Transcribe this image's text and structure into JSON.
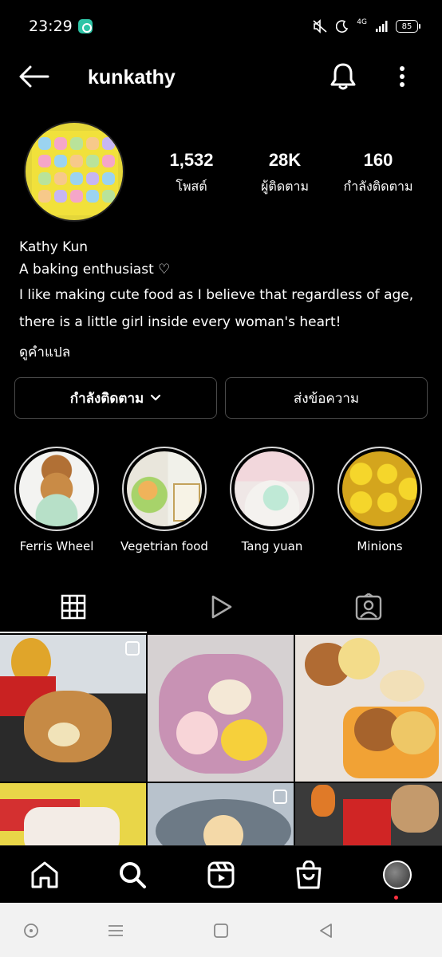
{
  "status_bar": {
    "time": "23:29",
    "network": "4G",
    "battery": "85"
  },
  "header": {
    "username": "kunkathy"
  },
  "stats": {
    "posts_count": "1,532",
    "posts_label": "โพสต์",
    "followers_count": "28K",
    "followers_label": "ผู้ติดตาม",
    "following_count": "160",
    "following_label": "กำลังติดตาม"
  },
  "bio": {
    "name": "Kathy Kun",
    "line1": "A baking enthusiast ♡",
    "line2": "I like making cute food as I believe that regardless of age,",
    "line3": "there is a little girl inside every woman's heart!",
    "translate": "ดูคำแปล"
  },
  "buttons": {
    "following": "กำลังติดตาม",
    "message": "ส่งข้อความ"
  },
  "highlights": [
    {
      "label": "Ferris Wheel"
    },
    {
      "label": "Vegetrian food"
    },
    {
      "label": "Tang yuan"
    },
    {
      "label": "Minions"
    }
  ],
  "tabs": {
    "active": "grid",
    "items": [
      "grid-icon",
      "reels-icon",
      "tagged-icon"
    ]
  },
  "bottom_nav": {
    "items": [
      "home-icon",
      "search-icon",
      "reels-icon",
      "shop-icon",
      "profile-avatar"
    ],
    "active": "search-icon"
  },
  "colors": {
    "background": "#000000",
    "text": "#ffffff",
    "button_border": "#4a4a4a",
    "notification_dot": "#ff3040"
  }
}
